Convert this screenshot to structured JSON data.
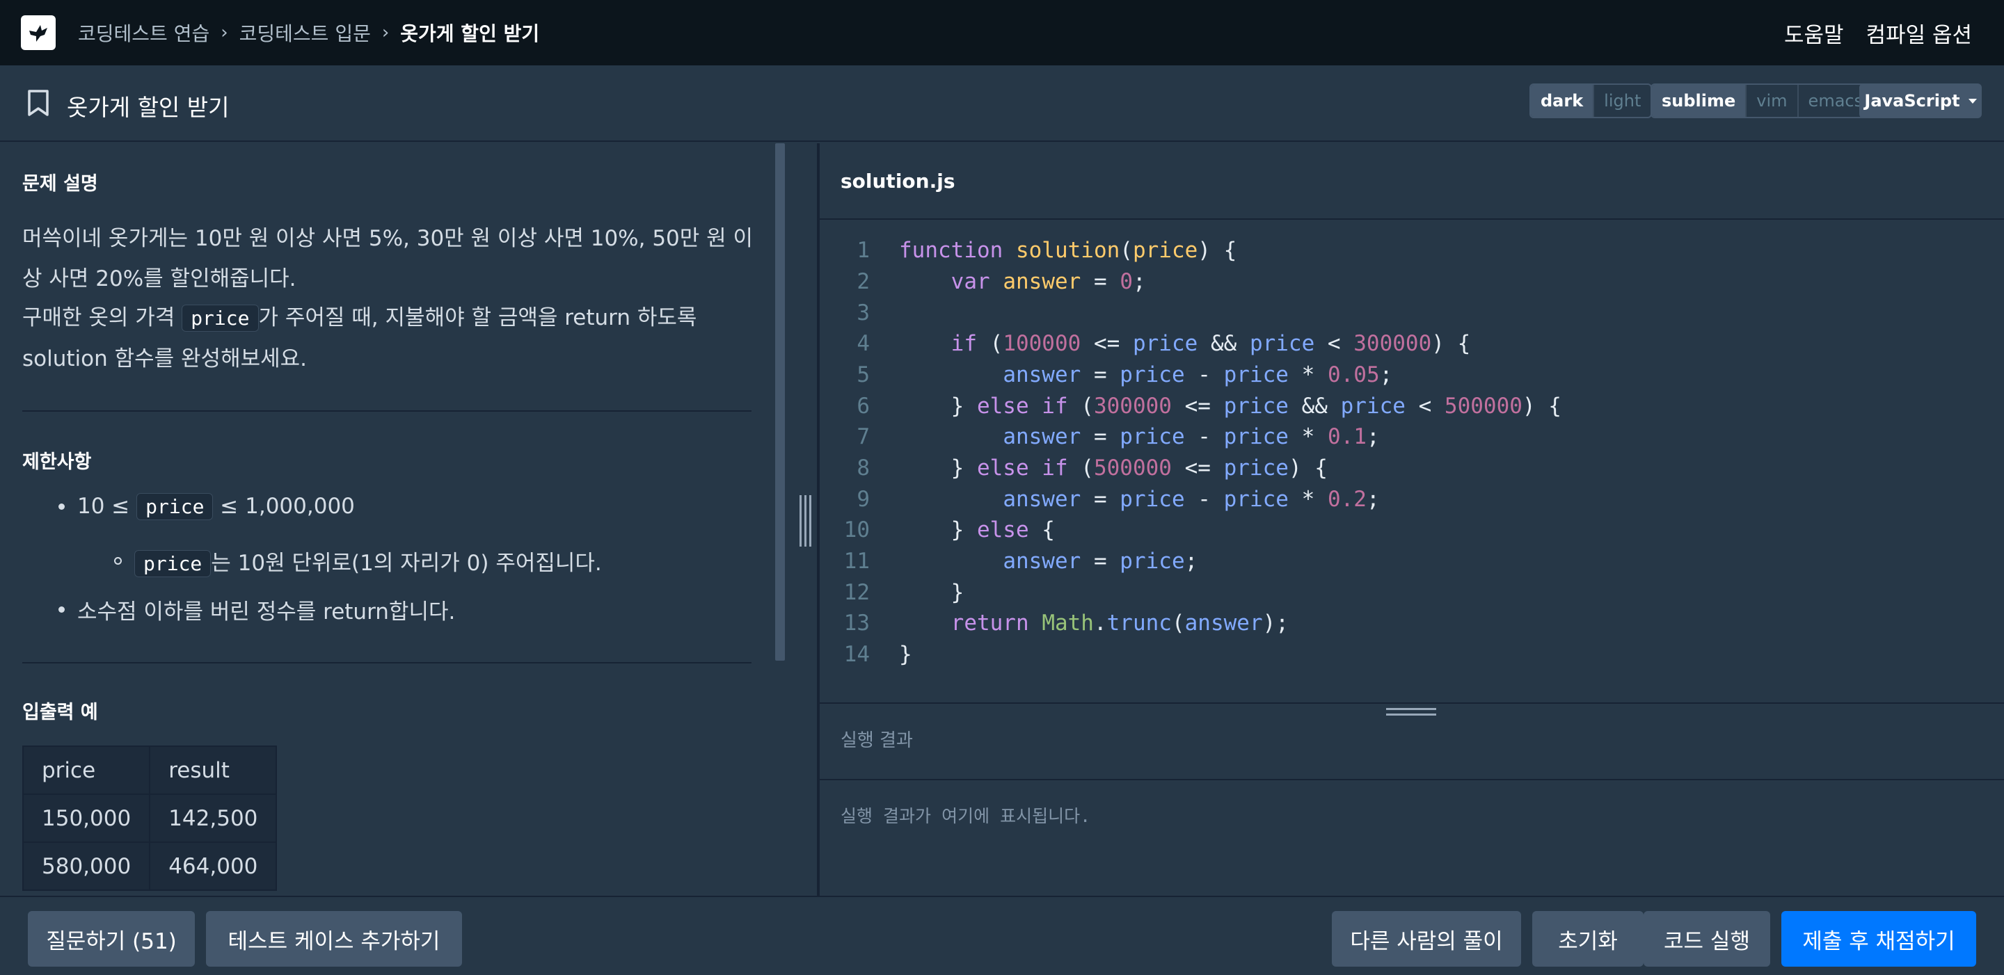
{
  "topnav": {
    "breadcrumb": [
      "코딩테스트 연습",
      "코딩테스트 입문",
      "옷가게 할인 받기"
    ],
    "help": "도움말",
    "compile_options": "컴파일 옵션"
  },
  "titlebar": {
    "title": "옷가게 할인 받기",
    "theme_options": [
      "dark",
      "light"
    ],
    "theme_selected": "dark",
    "keymap_options": [
      "sublime",
      "vim",
      "emacs"
    ],
    "keymap_selected": "sublime",
    "language": "JavaScript"
  },
  "problem": {
    "description_title": "문제 설명",
    "description_line1": "머쓱이네 옷가게는 10만 원 이상 사면 5%, 30만 원 이상 사면 10%, 50만 원 이",
    "description_line2": "상 사면 20%를 할인해줍니다.",
    "description_line3_pre": "구매한 옷의 가격 ",
    "description_line3_code": "price",
    "description_line3_post": "가 주어질 때, 지불해야 할 금액을 return 하도록",
    "description_line4": "solution 함수를 완성해보세요.",
    "constraints_title": "제한사항",
    "constraint1_pre": "10 ≤ ",
    "constraint1_code": "price",
    "constraint1_post": " ≤ 1,000,000",
    "constraint1a_code": "price",
    "constraint1a_post": "는 10원 단위로(1의 자리가 0) 주어집니다.",
    "constraint2": "소수점 이하를 버린 정수를 return합니다.",
    "io_title": "입출력 예",
    "io_headers": [
      "price",
      "result"
    ],
    "io_rows": [
      [
        "150,000",
        "142,500"
      ],
      [
        "580,000",
        "464,000"
      ]
    ]
  },
  "editor": {
    "filename": "solution.js",
    "line_numbers": [
      "1",
      "2",
      "3",
      "4",
      "5",
      "6",
      "7",
      "8",
      "9",
      "10",
      "11",
      "12",
      "13",
      "14"
    ]
  },
  "result": {
    "title": "실행 결과",
    "placeholder": "실행 결과가 여기에 표시됩니다."
  },
  "bottombar": {
    "ask": "질문하기 (51)",
    "add_testcase": "테스트 케이스 추가하기",
    "others_solution": "다른 사람의 풀이",
    "reset": "초기화",
    "run": "코드 실행",
    "submit": "제출 후 채점하기"
  },
  "colors": {
    "nav_bg": "#0c151c",
    "panel_bg": "#263747",
    "button_bg": "#44576c",
    "primary": "#0078ff"
  }
}
